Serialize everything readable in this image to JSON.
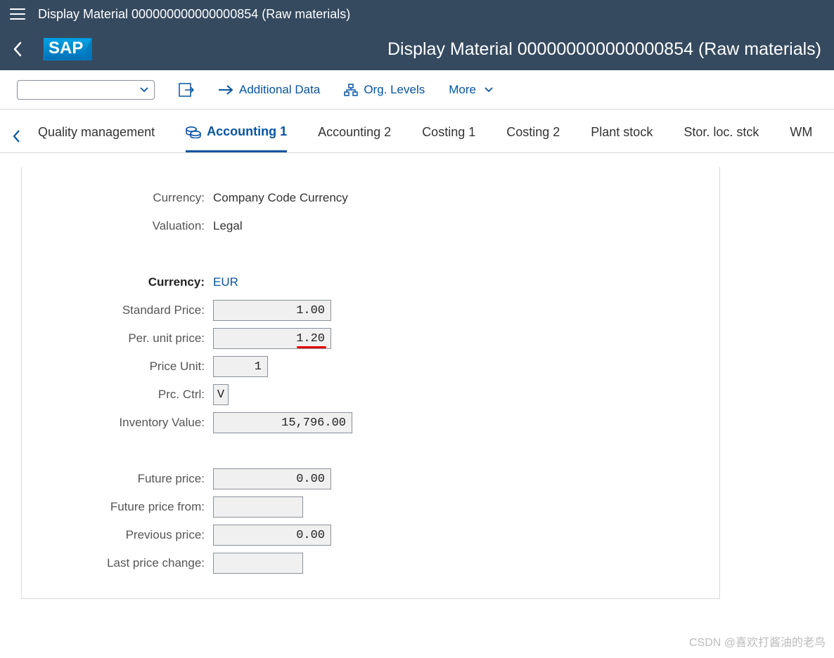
{
  "titleBar": {
    "text": "Display Material 000000000000000854 (Raw materials)"
  },
  "shell": {
    "title": "Display Material 000000000000000854 (Raw materials)",
    "logo": "SAP"
  },
  "toolbar": {
    "dropdown_value": "",
    "additional_data": "Additional Data",
    "org_levels": "Org. Levels",
    "more": "More"
  },
  "tabs": {
    "prev": "Quality management",
    "active": "Accounting 1",
    "items": [
      "Accounting 2",
      "Costing 1",
      "Costing 2",
      "Plant stock",
      "Stor. loc. stck",
      "WM"
    ]
  },
  "fields": {
    "currency_label": "Currency:",
    "currency_value": "Company Code Currency",
    "valuation_label": "Valuation:",
    "valuation_value": "Legal",
    "currency2_label": "Currency:",
    "currency2_value": "EUR",
    "std_price_label": "Standard Price:",
    "std_price_value": "1.00",
    "per_unit_label": "Per. unit price:",
    "per_unit_value": "1.20",
    "price_unit_label": "Price Unit:",
    "price_unit_value": "1",
    "prc_ctrl_label": "Prc. Ctrl:",
    "prc_ctrl_value": "V",
    "inv_value_label": "Inventory Value:",
    "inv_value_value": "15,796.00",
    "future_price_label": "Future price:",
    "future_price_value": "0.00",
    "future_from_label": "Future price from:",
    "future_from_value": "",
    "prev_price_label": "Previous price:",
    "prev_price_value": "0.00",
    "last_change_label": "Last price change:",
    "last_change_value": ""
  },
  "watermark": "CSDN @喜欢打酱油的老鸟"
}
